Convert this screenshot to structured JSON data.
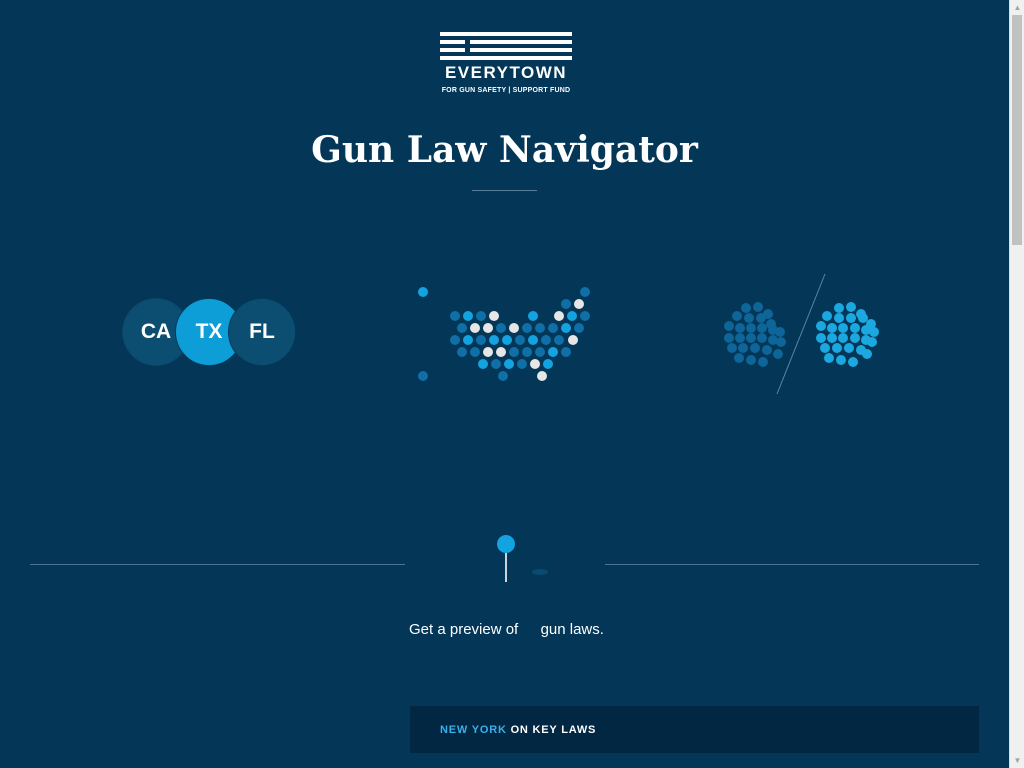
{
  "brand": {
    "wordmark": "EVERYTOWN",
    "tagline": "FOR GUN SAFETY | SUPPORT FUND"
  },
  "page_title": "Gun Law Navigator",
  "features": {
    "compare_states": [
      "CA",
      "TX",
      "FL"
    ]
  },
  "preview": {
    "prefix": "Get a preview of",
    "suffix": "gun laws."
  },
  "key_laws": {
    "state": "NEW YORK",
    "suffix": "ON KEY LAWS"
  },
  "colors": {
    "background": "#033657",
    "accent": "#12a3e0",
    "dark_panel": "#022743",
    "highlight_text": "#39b1e8"
  },
  "scrollbar": {
    "up_icon": "triangle-up",
    "down_icon": "triangle-down"
  }
}
